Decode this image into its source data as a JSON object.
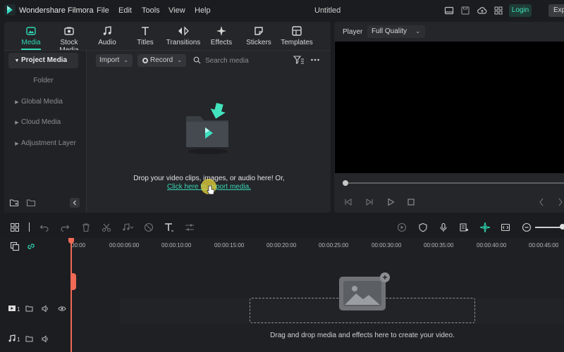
{
  "app": {
    "name": "Wondershare Filmora",
    "menus": [
      "File",
      "Edit",
      "Tools",
      "View",
      "Help"
    ],
    "doc_title": "Untitled",
    "login_label": "Login",
    "export_label": "Exp"
  },
  "media_tabs": [
    {
      "label": "Media",
      "icon": "media-icon"
    },
    {
      "label": "Stock Media",
      "icon": "stock-media-icon"
    },
    {
      "label": "Audio",
      "icon": "music-note-icon"
    },
    {
      "label": "Titles",
      "icon": "text-t-icon"
    },
    {
      "label": "Transitions",
      "icon": "transitions-icon"
    },
    {
      "label": "Effects",
      "icon": "sparkle-icon"
    },
    {
      "label": "Stickers",
      "icon": "sticker-icon"
    },
    {
      "label": "Templates",
      "icon": "templates-icon"
    }
  ],
  "sidebar": {
    "items": [
      {
        "label": "Project Media"
      },
      {
        "label": "Folder"
      },
      {
        "label": "Global Media"
      },
      {
        "label": "Cloud Media"
      },
      {
        "label": "Adjustment Layer"
      }
    ]
  },
  "media_toolbar": {
    "import_label": "Import",
    "record_label": "Record",
    "search_placeholder": "Search media"
  },
  "media_empty": {
    "drop_text": "Drop your video clips, images, or audio here! Or,",
    "link_text": "Click here to import media."
  },
  "player": {
    "label": "Player",
    "quality": "Full Quality"
  },
  "timeline": {
    "ruler_labels": [
      "00:00",
      "00:00:05:00",
      "00:00:10:00",
      "00:00:15:00",
      "00:00:20:00",
      "00:00:25:00",
      "00:00:30:00",
      "00:00:35:00",
      "00:00:40:00",
      "00:00:45:00"
    ],
    "drop_hint": "Drag and drop media and effects here to create your video.",
    "video_track_num": "1",
    "audio_track_num": "1"
  },
  "colors": {
    "accent": "#2fd8b3",
    "playhead": "#f06a55",
    "cursor_highlight": "#e8d63c"
  }
}
